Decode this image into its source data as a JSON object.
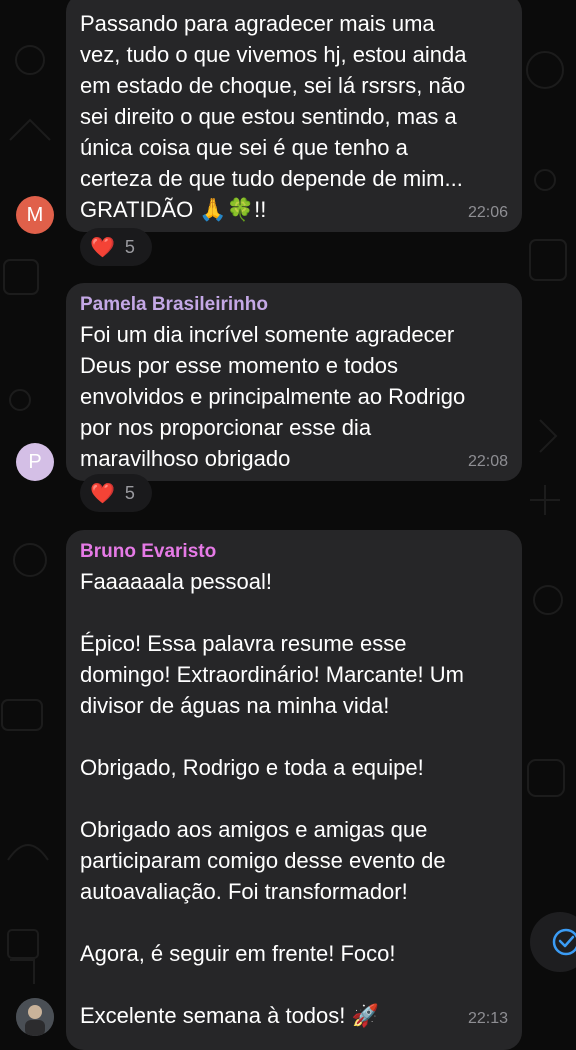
{
  "messages": [
    {
      "sender": "",
      "avatar_letter": "M",
      "lines": [
        "Passando para agradecer mais uma",
        "vez, tudo o que vivemos hj, estou ainda",
        "em estado de choque, sei lá rsrsrs, não",
        "sei direito o que estou sentindo, mas a",
        "única coisa que sei é que tenho a",
        "certeza de que tudo depende de mim...",
        "GRATIDÃO 🙏🍀!!"
      ],
      "time": "22:06",
      "reaction": {
        "emoji": "❤️",
        "count": "5"
      }
    },
    {
      "sender": "Pamela Brasileirinho",
      "avatar_letter": "P",
      "lines": [
        "Foi um dia incrível somente agradecer",
        "Deus por esse momento e todos",
        "envolvidos e principalmente ao Rodrigo",
        "por nos proporcionar esse dia",
        "maravilhoso obrigado"
      ],
      "time": "22:08",
      "reaction": {
        "emoji": "❤️",
        "count": "5"
      }
    },
    {
      "sender": "Bruno Evaristo",
      "lines": [
        "Faaaaaala pessoal!",
        "",
        "Épico! Essa palavra resume esse",
        "domingo! Extraordinário! Marcante! Um",
        "divisor de águas na minha vida!",
        "",
        "Obrigado, Rodrigo e toda a equipe!",
        "",
        "Obrigado aos amigos e amigas que",
        "participaram comigo desse evento de",
        "autoavaliação. Foi transformador!",
        "",
        "Agora, é seguir em frente! Foco!",
        "",
        "Excelente semana à todos! 🚀"
      ],
      "time": "22:13"
    }
  ],
  "colors": {
    "bubble": "#262628",
    "pamela_name": "#c4a8e6",
    "bruno_name": "#e57ae6",
    "avatar_m": "#e0604a",
    "avatar_p": "#d4bfe6",
    "scroll_check": "#3b9cf5"
  },
  "icons": {
    "scroll_button": "double-check-down-icon",
    "bruno_avatar": "profile-photo-avatar"
  }
}
